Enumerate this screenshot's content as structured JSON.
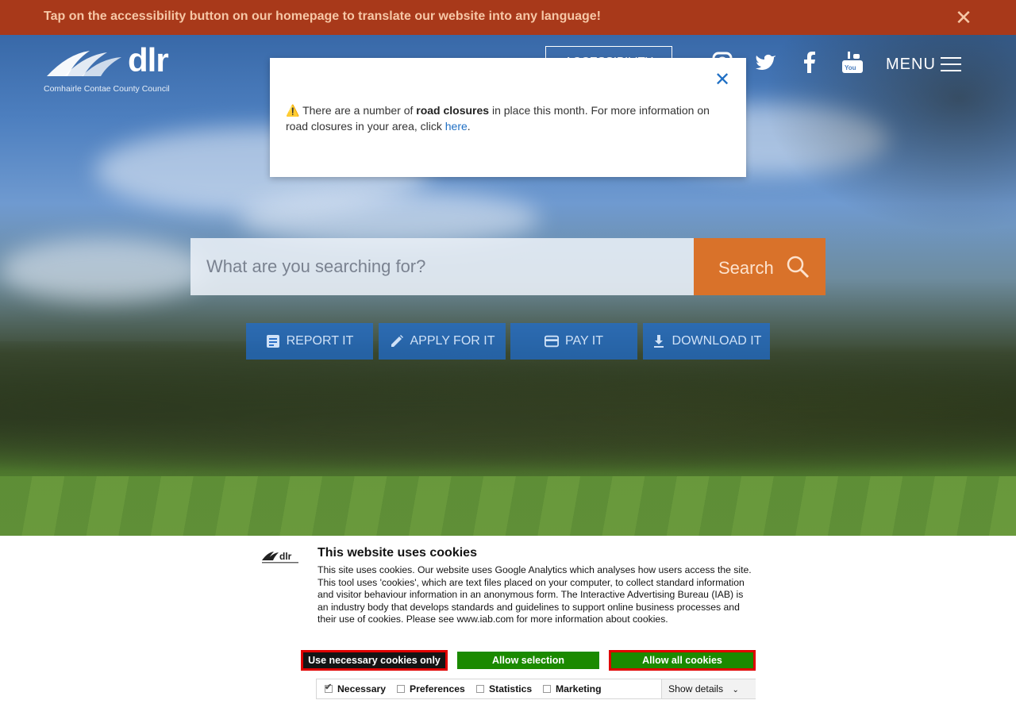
{
  "banner": {
    "text": "Tap on the accessibility button on our homepage to translate our website into any language!",
    "close_icon": "close-icon"
  },
  "header": {
    "logo_word": "dlr",
    "logo_subtitle": "Comhairle Contae County Council",
    "accessibility_label": "ACCESSIBILITY",
    "social_icons": [
      "instagram-icon",
      "twitter-icon",
      "facebook-icon",
      "youtube-icon"
    ],
    "menu_label": "MENU"
  },
  "notice": {
    "icon": "warning-icon",
    "text_before": "There are a number of ",
    "text_bold": "road closures",
    "text_middle": " in place this month. For more information on road closures in your area, click ",
    "link_text": "here",
    "text_after": "."
  },
  "search": {
    "placeholder": "What are you searching for?",
    "button_label": "Search"
  },
  "quick_links": [
    {
      "label": "REPORT IT",
      "icon": "document-icon"
    },
    {
      "label": "APPLY FOR IT",
      "icon": "pencil-icon"
    },
    {
      "label": "PAY IT",
      "icon": "credit-card-icon"
    },
    {
      "label": "DOWNLOAD IT",
      "icon": "download-icon"
    }
  ],
  "cookies": {
    "title": "This website uses cookies",
    "body": "This site uses cookies. Our website uses Google Analytics which analyses how users access the site. This tool uses 'cookies', which are text files placed on your computer, to collect standard information and visitor behaviour information in an anonymous form. The Interactive Advertising Bureau (IAB) is an industry body that develops standards and guidelines to support online business processes and their use of cookies. Please see www.iab.com for more information about cookies.",
    "btn_necessary": "Use necessary cookies only",
    "btn_selection": "Allow selection",
    "btn_all": "Allow all cookies",
    "options": [
      {
        "label": "Necessary",
        "checked": true
      },
      {
        "label": "Preferences",
        "checked": false
      },
      {
        "label": "Statistics",
        "checked": false
      },
      {
        "label": "Marketing",
        "checked": false
      }
    ],
    "show_details": "Show details"
  },
  "colors": {
    "banner_bg": "#a8391a",
    "accent_orange": "#d9722a",
    "link_blue": "#1f6fc4",
    "cookie_green": "#1b8a00",
    "highlight_red": "#e00000"
  }
}
